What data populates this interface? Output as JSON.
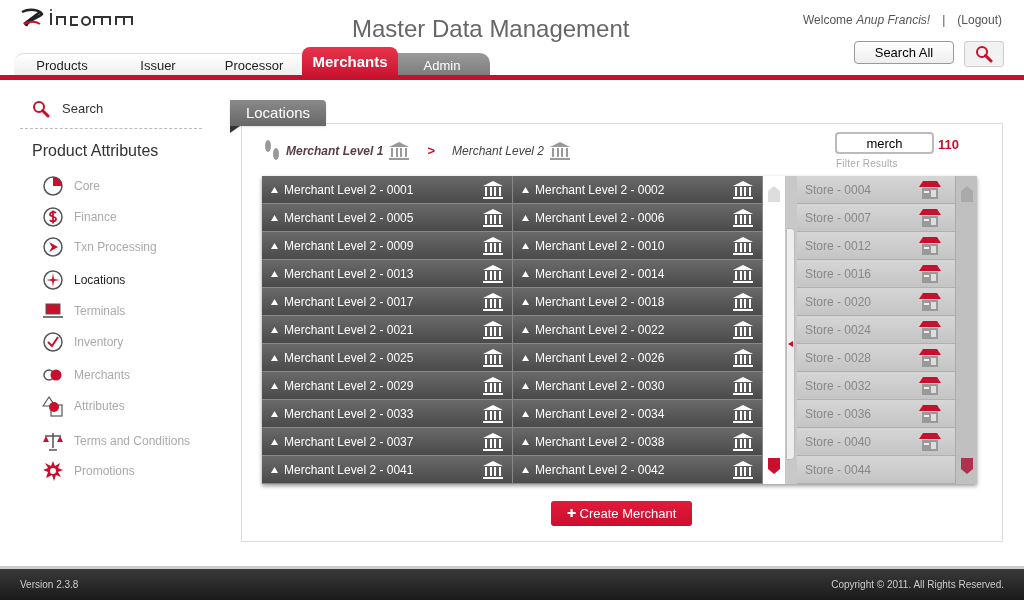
{
  "header": {
    "title": "Master Data Management",
    "welcome": "Welcome",
    "user": "Anup Francis!",
    "separator": "|",
    "logout": "(Logout)",
    "search_button": "Search All"
  },
  "tabs": [
    {
      "label": "Products",
      "kind": "light",
      "selected": false
    },
    {
      "label": "Issuer",
      "kind": "light",
      "selected": false
    },
    {
      "label": "Processor",
      "kind": "light",
      "selected": false
    },
    {
      "label": "Merchants",
      "kind": "light",
      "selected": true
    },
    {
      "label": "Admin",
      "kind": "dark",
      "selected": false
    }
  ],
  "sidebar": {
    "search": "Search",
    "heading": "Product Attributes",
    "items": [
      {
        "label": "Core",
        "selected": false
      },
      {
        "label": "Finance",
        "selected": false
      },
      {
        "label": "Txn Processing",
        "selected": false
      },
      {
        "label": "Locations",
        "selected": true
      },
      {
        "label": "Terminals",
        "selected": false
      },
      {
        "label": "Inventory",
        "selected": false
      },
      {
        "label": "Merchants",
        "selected": false
      },
      {
        "label": "Attributes",
        "selected": false
      },
      {
        "label": "Terms and Conditions",
        "selected": false
      },
      {
        "label": "Promotions",
        "selected": false
      }
    ]
  },
  "panel": {
    "title": "Locations",
    "breadcrumb": [
      {
        "label": "Merchant Level 1"
      },
      {
        "label": "Merchant Level 2"
      }
    ],
    "breadcrumb_separator": ">",
    "filter": {
      "value": "merch",
      "hint": "Filter Results",
      "count": "110"
    },
    "merchants": [
      "Merchant Level 2 - 0001",
      "Merchant Level 2 - 0002",
      "Merchant Level 2 - 0005",
      "Merchant Level 2 - 0006",
      "Merchant Level 2 - 0009",
      "Merchant Level 2 - 0010",
      "Merchant Level 2 - 0013",
      "Merchant Level 2 - 0014",
      "Merchant Level 2 - 0017",
      "Merchant Level 2 - 0018",
      "Merchant Level 2 - 0021",
      "Merchant Level 2 - 0022",
      "Merchant Level 2 - 0025",
      "Merchant Level 2 - 0026",
      "Merchant Level 2 - 0029",
      "Merchant Level 2 - 0030",
      "Merchant Level 2 - 0033",
      "Merchant Level 2 - 0034",
      "Merchant Level 2 - 0037",
      "Merchant Level 2 - 0038",
      "Merchant Level 2 - 0041",
      "Merchant Level 2 - 0042"
    ],
    "stores": [
      {
        "label": "Store - 0004",
        "icon": true
      },
      {
        "label": "Store - 0007",
        "icon": true
      },
      {
        "label": "Store - 0012",
        "icon": true
      },
      {
        "label": "Store - 0016",
        "icon": true
      },
      {
        "label": "Store - 0020",
        "icon": true
      },
      {
        "label": "Store - 0024",
        "icon": true
      },
      {
        "label": "Store - 0028",
        "icon": true
      },
      {
        "label": "Store - 0032",
        "icon": true
      },
      {
        "label": "Store - 0036",
        "icon": true
      },
      {
        "label": "Store - 0040",
        "icon": true
      },
      {
        "label": "Store - 0044",
        "icon": false
      }
    ],
    "create_button": "Create Merchant",
    "create_icon": "✚"
  },
  "footer": {
    "version": "Version 2.3.8",
    "copyright": "Copyright © 2011. All Rights Reserved."
  }
}
